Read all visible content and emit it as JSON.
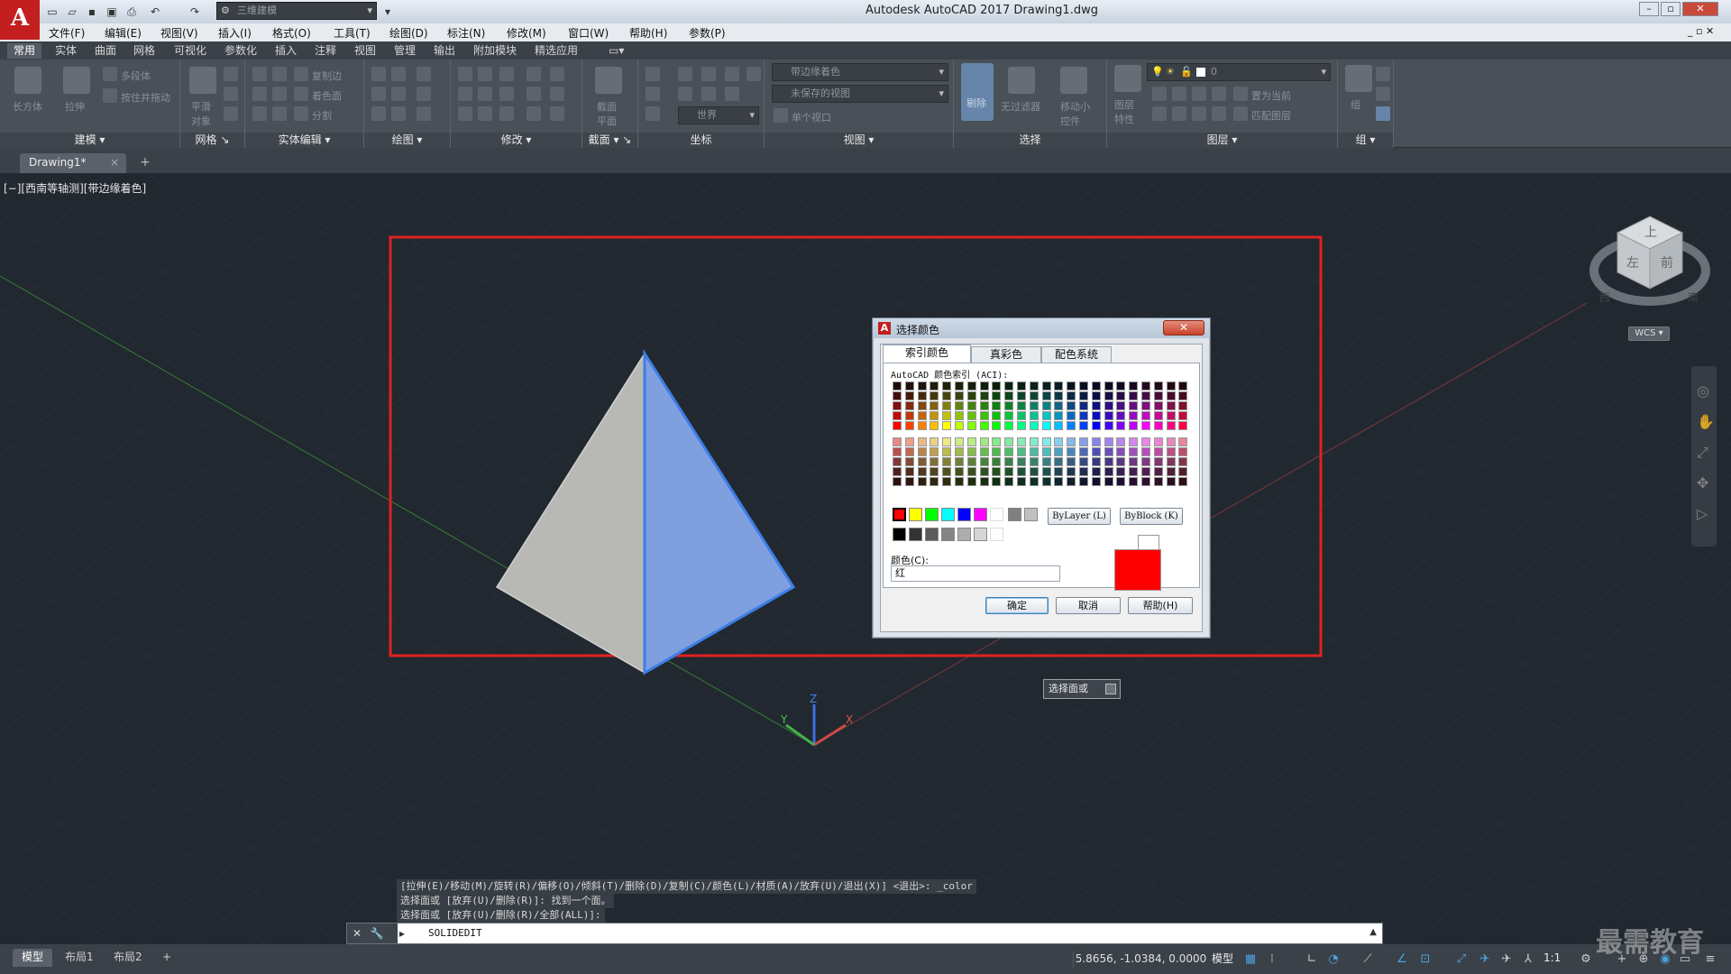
{
  "app": {
    "logo_letter": "A",
    "window_title": "Autodesk AutoCAD 2017    Drawing1.dwg",
    "workspace": "三维建模"
  },
  "menu": [
    "文件(F)",
    "编辑(E)",
    "视图(V)",
    "插入(I)",
    "格式(O)",
    "工具(T)",
    "绘图(D)",
    "标注(N)",
    "修改(M)",
    "窗口(W)",
    "帮助(H)",
    "参数(P)"
  ],
  "ribbon_tabs": [
    "常用",
    "实体",
    "曲面",
    "网格",
    "可视化",
    "参数化",
    "插入",
    "注释",
    "视图",
    "管理",
    "输出",
    "附加模块",
    "精选应用"
  ],
  "ribbon_panels": {
    "modeling": {
      "title": "建模",
      "box": "长方体",
      "extrude": "拉伸",
      "polysolid": "多段体",
      "presspull": "按住并拖动"
    },
    "mesh": {
      "title": "网格",
      "smooth": "平滑对象"
    },
    "solid_edit": {
      "title": "实体编辑",
      "copy_edge": "复制边",
      "extract_face": "着色面",
      "separate": "分割"
    },
    "draw": {
      "title": "绘图"
    },
    "modify": {
      "title": "修改"
    },
    "section": {
      "title": "截面",
      "plane": "截面平面"
    },
    "coordinates": {
      "title": "坐标",
      "world": "世界"
    },
    "view": {
      "title": "视图",
      "visual_style": "带边缘着色",
      "saved_view": "未保存的视图",
      "single_viewport": "单个视口"
    },
    "selection": {
      "title": "选择",
      "culling": "剔除",
      "no_filter": "无过滤器",
      "move_gizmo": "移动小控件"
    },
    "layers": {
      "title": "图层",
      "layer_props": "图层特性",
      "layer_name": "0",
      "set_current": "置为当前",
      "match_layer": "匹配图层"
    },
    "groups": {
      "title": "组",
      "group": "组"
    }
  },
  "file_tab": {
    "name": "Drawing1*",
    "close": "×",
    "add": "+"
  },
  "viewport_label": "[−][西南等轴测][带边缘着色]",
  "ucs": {
    "x": "X",
    "y": "Y",
    "z": "Z"
  },
  "viewcube": {
    "top": "上",
    "front": "前",
    "left": "左",
    "west": "西",
    "south": "南",
    "wcs": "WCS"
  },
  "dialog": {
    "title": "选择颜色",
    "close": "✕",
    "tabs": [
      "索引颜色",
      "真彩色",
      "配色系统"
    ],
    "aci_label": "AutoCAD 颜色索引 (ACI):",
    "bylayer": "ByLayer (L)",
    "byblock": "ByBlock (K)",
    "color_label": "颜色(C):",
    "color_value": "红",
    "ok": "确定",
    "cancel": "取消",
    "help": "帮助(H)",
    "selected_color": "#ff0000"
  },
  "tooltip": {
    "text": "选择面或"
  },
  "command": {
    "history": [
      "[拉伸(E)/移动(M)/旋转(R)/偏移(O)/倾斜(T)/删除(D)/复制(C)/颜色(L)/材质(A)/放弃(U)/退出(X)] <退出>: _color",
      "选择面或 [放弃(U)/删除(R)]: 找到一个面。",
      "选择面或 [放弃(U)/删除(R)/全部(ALL)]:"
    ],
    "input": "SOLIDEDIT"
  },
  "status": {
    "tabs": [
      "模型",
      "布局1",
      "布局2"
    ],
    "add": "+",
    "coordinates": "5.8656, -1.0384, 0.0000",
    "model": "模型",
    "scale": "1:1",
    "watermark": "最需教育"
  },
  "colors": {
    "accent_red": "#e02020",
    "face_blue": "#7f9fdf",
    "face_gray": "#b8b9b4",
    "edge_blue": "#3d7ee8"
  }
}
